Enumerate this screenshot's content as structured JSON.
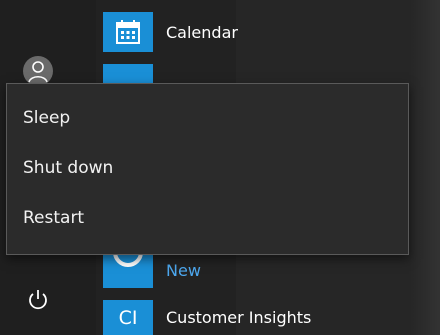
{
  "apps": [
    {
      "label": "Calendar",
      "icon": "calendar-icon"
    },
    {
      "label": "New",
      "icon": "ring-icon"
    },
    {
      "label": "Customer Insights",
      "icon_text": "CI"
    }
  ],
  "power_menu": {
    "items": [
      {
        "label": "Sleep"
      },
      {
        "label": "Shut down"
      },
      {
        "label": "Restart"
      }
    ]
  },
  "colors": {
    "accent": "#1a8fd6",
    "new_label": "#4da8ef",
    "menu_bg": "#2b2b2b"
  }
}
